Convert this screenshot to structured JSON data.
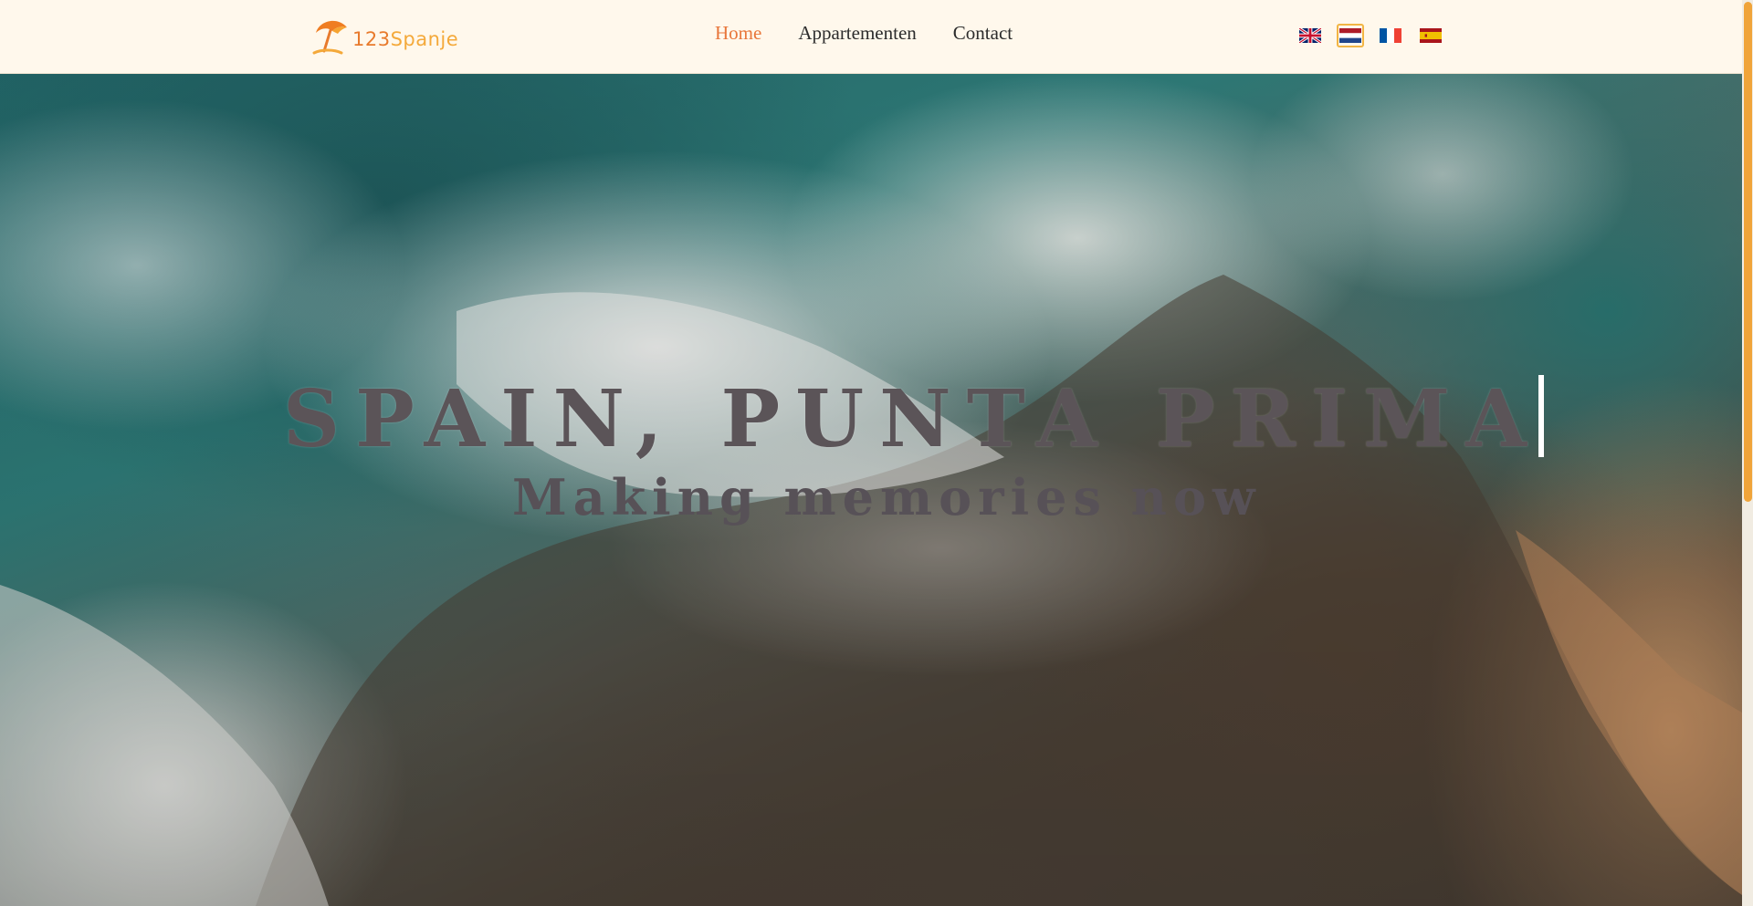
{
  "brand": {
    "logo_number": "123",
    "logo_word": "Spanje",
    "icon": "beach-umbrella-icon",
    "colors": {
      "orange": "#e87a2c",
      "yellow": "#f4a93a"
    }
  },
  "nav": {
    "items": [
      {
        "label": "Home",
        "active": true
      },
      {
        "label": "Appartementen",
        "active": false
      },
      {
        "label": "Contact",
        "active": false
      }
    ],
    "active_color": "#e8763a"
  },
  "languages": [
    {
      "code": "en",
      "icon": "uk-flag-icon",
      "selected": false
    },
    {
      "code": "nl",
      "icon": "netherlands-flag-icon",
      "selected": true
    },
    {
      "code": "fr",
      "icon": "france-flag-icon",
      "selected": false
    },
    {
      "code": "es",
      "icon": "spain-flag-icon",
      "selected": false
    }
  ],
  "hero": {
    "title": "SPAIN, PUNTA PRIMA",
    "subtitle": "Making memories now",
    "background": "aerial-ocean-rocks-image"
  }
}
